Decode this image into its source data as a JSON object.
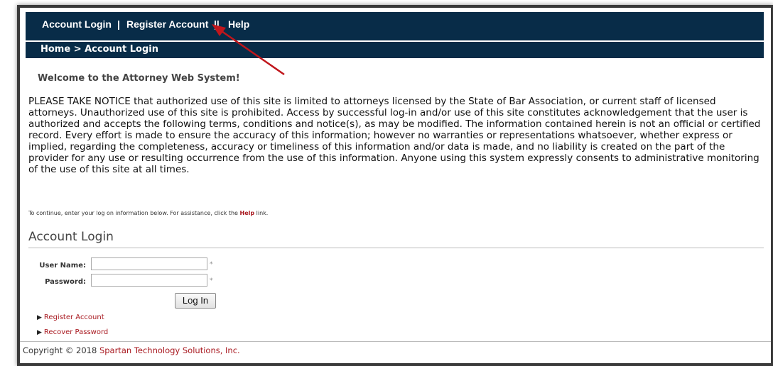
{
  "nav": {
    "account_login": "Account Login",
    "register_account": "Register Account",
    "help": "Help",
    "sep1": "|",
    "sep2": "||"
  },
  "breadcrumb": "Home > Account Login",
  "welcome": "Welcome to the Attorney Web System!",
  "notice": "PLEASE TAKE NOTICE that authorized use of this site is limited to attorneys licensed by the State of Bar Association, or current staff of licensed attorneys. Unauthorized use of this site is prohibited. Access by successful log-in and/or use of this site constitutes acknowledgement that the user is authorized and accepts the following terms, conditions and notice(s), as may be modified. The information contained herein is not an official or certified record. Every effort is made to ensure the accuracy of this information; however no warranties or representations whatsoever, whether express or implied, regarding the completeness, accuracy or timeliness of this information and/or data is made, and no liability is created on the part of the provider for any use or resulting occurrence from the use of this information. Anyone using this system expressly consents to administrative monitoring of the use of this site at all times.",
  "hint": {
    "before": "To continue, enter your log on information below. For assistance, click the ",
    "help": "Help",
    "after": " link."
  },
  "login": {
    "title": "Account Login",
    "username_label": "User Name:",
    "username_value": "",
    "password_label": "Password:",
    "password_value": "",
    "required_marker": "*",
    "submit": "Log In"
  },
  "links": {
    "register": "Register Account",
    "recover": "Recover Password"
  },
  "footer": {
    "copyright": "Copyright © 2018 ",
    "company": "Spartan Technology Solutions, Inc."
  },
  "colors": {
    "nav_background": "#082c48",
    "link_red": "#a8181f",
    "annotation_arrow": "#c0161c"
  },
  "icons": {
    "link_arrow": "triangle-right-icon"
  }
}
